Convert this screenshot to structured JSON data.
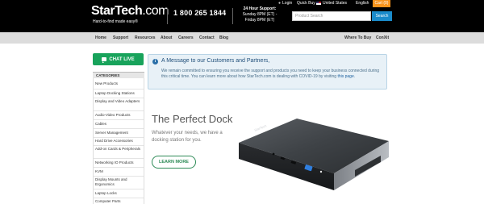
{
  "header": {
    "logo_main": "StarTech",
    "logo_suffix": ".com",
    "logo_tagline": "Hard-to-find made easy®",
    "phone": "1 800 265 1844",
    "support_line1": "24 Hour Support:",
    "support_line2": "Sunday 8PM (ET) -",
    "support_line3": "Friday 8PM (ET)",
    "login": "Login",
    "quick_buy": "Quick Buy",
    "country": "United States",
    "language": "English",
    "cart": "Cart (0)",
    "search_placeholder": "Product Search",
    "search_button": "Search"
  },
  "nav": {
    "items": [
      "Home",
      "Support",
      "Resources",
      "About",
      "Careers",
      "Contact",
      "Blog"
    ],
    "right_items": [
      "Where To Buy",
      "ConXit"
    ]
  },
  "sidebar": {
    "chat_label": "CHAT LIVE",
    "categories_heading": "CATEGORIES",
    "categories": [
      "New Products",
      "Laptop Docking Stations",
      "Display and Video Adapters",
      "Audio-Video Products",
      "Cables",
      "Server Management",
      "Hard Drive Accessories",
      "Add-on Cards & Peripherals",
      "Networking IO Products",
      "KVM",
      "Display Mounts and Ergonomics",
      "Laptop Locks",
      "Computer Parts"
    ]
  },
  "alert": {
    "title": "A Message to our Customers and Partners,",
    "text": "We remain committed to ensuring you receive the support and products you need to keep your business connected during this critical time. You can learn more about how StarTech.com is dealing with COVID-19 by visiting ",
    "link": "this page",
    "text_end": "."
  },
  "hero": {
    "title": "The Perfect Dock",
    "subtitle": "Whatever your needs, we have a docking station for you.",
    "button": "LEARN MORE",
    "dock_brand": "StarTech"
  },
  "colors": {
    "header_bg": "#000000",
    "nav_bg": "#dcdcdc",
    "chat_green": "#18a35b",
    "search_blue": "#1a8bcb",
    "cart_orange": "#f7941d",
    "alert_bg": "#e8f1f7",
    "button_green": "#2e8b57"
  }
}
